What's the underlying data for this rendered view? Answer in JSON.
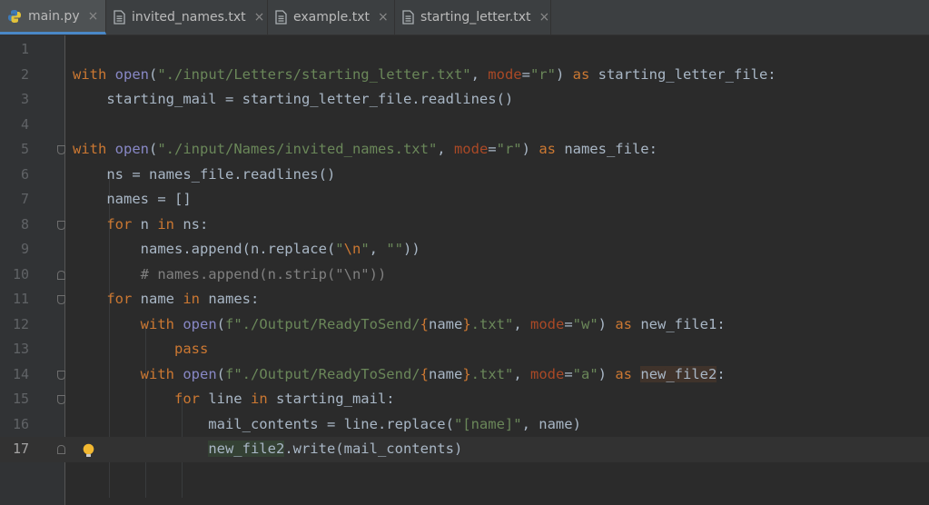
{
  "tabs": [
    {
      "label": "main.py",
      "icon": "python-icon",
      "active": true
    },
    {
      "label": "invited_names.txt",
      "icon": "text-file-icon"
    },
    {
      "label": "example.txt",
      "icon": "text-file-icon"
    },
    {
      "label": "starting_letter.txt",
      "icon": "text-file-icon"
    }
  ],
  "tab_close_glyph": "×",
  "current_line": 17,
  "editor": {
    "line_numbers": [
      "1",
      "2",
      "3",
      "4",
      "5",
      "6",
      "7",
      "8",
      "9",
      "10",
      "11",
      "12",
      "13",
      "14",
      "15",
      "16",
      "17"
    ],
    "lines": {
      "l2": [
        "with",
        " ",
        "open",
        "(",
        "\"./input/Letters/starting_letter.txt\"",
        ", ",
        "mode",
        "=",
        "\"r\"",
        ") ",
        "as",
        " starting_letter_file:"
      ],
      "l3": [
        "    starting_mail = starting_letter_file.readlines()"
      ],
      "l5": [
        "with",
        " ",
        "open",
        "(",
        "\"./input/Names/invited_names.txt\"",
        ", ",
        "mode",
        "=",
        "\"r\"",
        ") ",
        "as",
        " names_file:"
      ],
      "l6": [
        "    ns = names_file.readlines()"
      ],
      "l7": [
        "    names = []"
      ],
      "l8": [
        "    ",
        "for",
        " n ",
        "in",
        " ns:"
      ],
      "l9": [
        "        names.append(n.replace(",
        "\"",
        "\\n",
        "\"",
        ", ",
        "\"\"",
        "))"
      ],
      "l10": [
        "        ",
        "# names.append(n.strip(\"\\n\"))"
      ],
      "l11": [
        "    ",
        "for",
        " name ",
        "in",
        " names:"
      ],
      "l12": [
        "        ",
        "with",
        " ",
        "open",
        "(",
        "f\"./Output/ReadyToSend/",
        "{",
        "name",
        "}",
        ".txt\"",
        ", ",
        "mode",
        "=",
        "\"w\"",
        ") ",
        "as",
        " new_file1:"
      ],
      "l13": [
        "            ",
        "pass"
      ],
      "l14": [
        "        ",
        "with",
        " ",
        "open",
        "(",
        "f\"./Output/ReadyToSend/",
        "{",
        "name",
        "}",
        ".txt\"",
        ", ",
        "mode",
        "=",
        "\"a\"",
        ") ",
        "as",
        " ",
        "new_file2",
        ":"
      ],
      "l15": [
        "            ",
        "for",
        " line ",
        "in",
        " starting_mail:"
      ],
      "l16": [
        "                mail_contents = line.replace(",
        "\"[name]\"",
        ", name)"
      ],
      "l17": [
        "                ",
        "new_file2",
        ".write(mail_contents)"
      ]
    }
  },
  "colors": {
    "background": "#2b2b2b",
    "keyword": "#cc7832",
    "builtin": "#8888c6",
    "string": "#6a8759",
    "parameter": "#aa4926",
    "comment": "#808080",
    "identifier": "#a9b7c6"
  }
}
